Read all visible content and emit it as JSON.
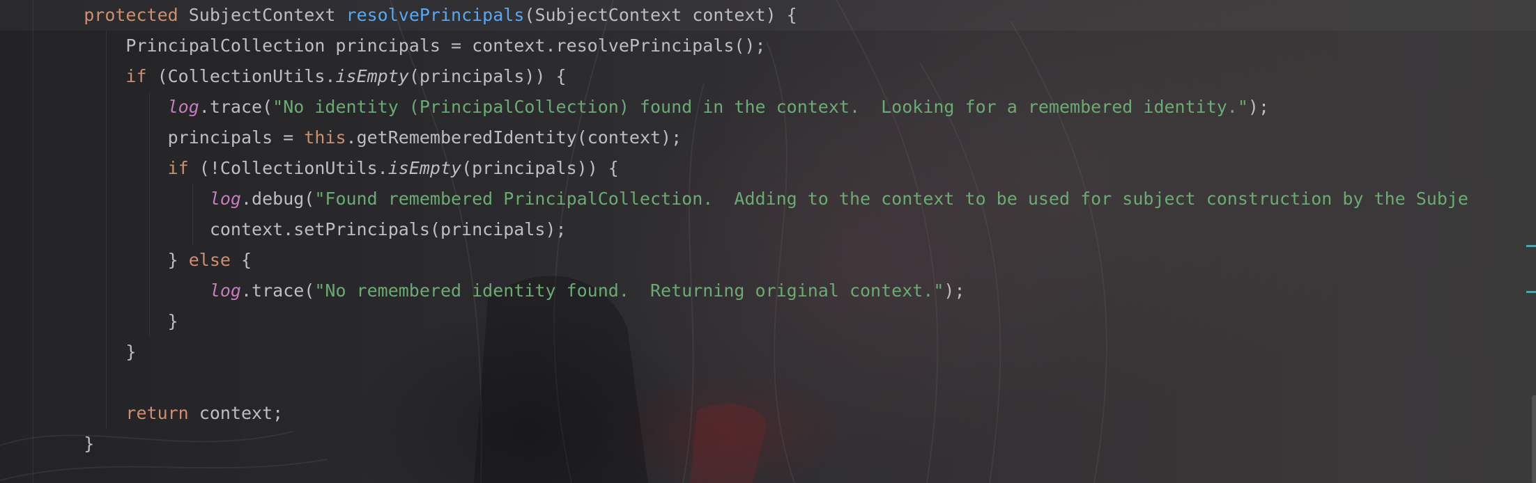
{
  "editor": {
    "lines": [
      [
        {
          "t": "    "
        },
        {
          "t": "protected",
          "s": "kw"
        },
        {
          "t": " SubjectContext "
        },
        {
          "t": "resolvePrincipals",
          "s": "fn"
        },
        {
          "t": "(SubjectContext context) {"
        }
      ],
      [
        {
          "t": "        PrincipalCollection principals = context.resolvePrincipals();"
        }
      ],
      [
        {
          "t": "        "
        },
        {
          "t": "if",
          "s": "kw"
        },
        {
          "t": " (CollectionUtils."
        },
        {
          "t": "isEmpty",
          "s": "it"
        },
        {
          "t": "(principals)) {"
        }
      ],
      [
        {
          "t": "            "
        },
        {
          "t": "log",
          "s": "field"
        },
        {
          "t": ".trace("
        },
        {
          "t": "\"No identity (PrincipalCollection) found in the context.  Looking for a remembered identity.\"",
          "s": "str"
        },
        {
          "t": ");"
        }
      ],
      [
        {
          "t": "            principals = "
        },
        {
          "t": "this",
          "s": "kw"
        },
        {
          "t": ".getRememberedIdentity(context);"
        }
      ],
      [
        {
          "t": "            "
        },
        {
          "t": "if",
          "s": "kw"
        },
        {
          "t": " (!CollectionUtils."
        },
        {
          "t": "isEmpty",
          "s": "it"
        },
        {
          "t": "(principals)) {"
        }
      ],
      [
        {
          "t": "                "
        },
        {
          "t": "log",
          "s": "field"
        },
        {
          "t": ".debug("
        },
        {
          "t": "\"Found remembered PrincipalCollection.  Adding to the context to be used for subject construction by the Subje",
          "s": "str"
        }
      ],
      [
        {
          "t": "                context.setPrincipals(principals);"
        }
      ],
      [
        {
          "t": "            } "
        },
        {
          "t": "else",
          "s": "kw"
        },
        {
          "t": " {"
        }
      ],
      [
        {
          "t": "                "
        },
        {
          "t": "log",
          "s": "field"
        },
        {
          "t": ".trace("
        },
        {
          "t": "\"No remembered identity found.  Returning original context.\"",
          "s": "str"
        },
        {
          "t": ");"
        }
      ],
      [
        {
          "t": "            }"
        }
      ],
      [
        {
          "t": "        }"
        }
      ],
      [
        {
          "t": ""
        }
      ],
      [
        {
          "t": "        "
        },
        {
          "t": "return",
          "s": "kw"
        },
        {
          "t": " context;"
        }
      ],
      [
        {
          "t": "    }"
        }
      ]
    ]
  }
}
